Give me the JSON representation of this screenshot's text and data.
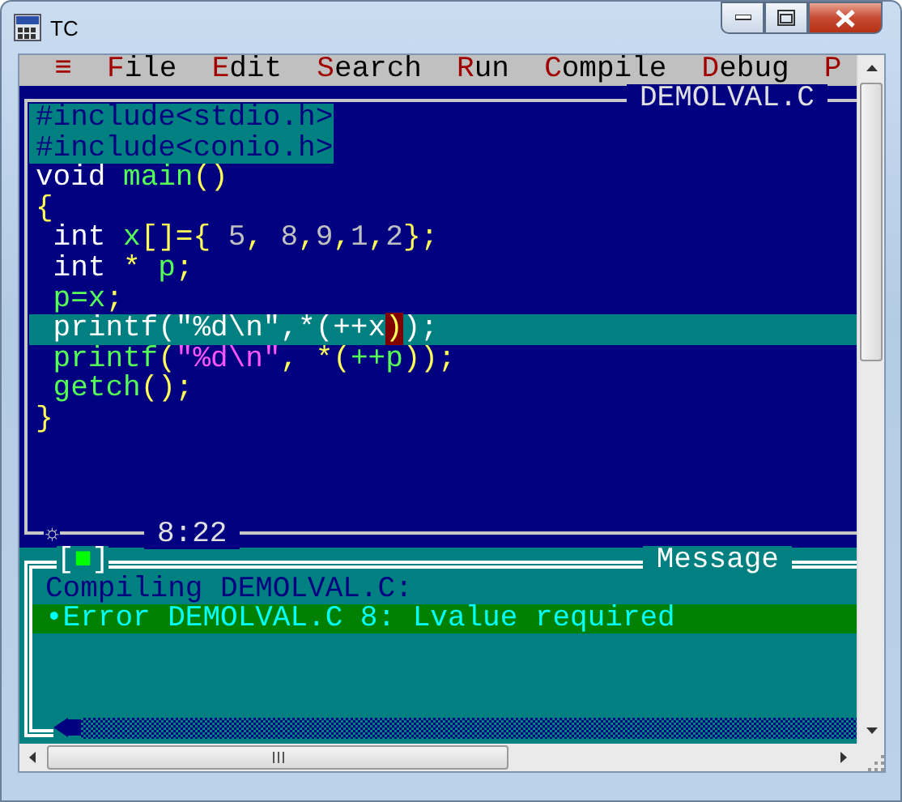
{
  "window": {
    "title": "TC"
  },
  "menu": [
    {
      "label": "≡"
    },
    {
      "label": "File"
    },
    {
      "label": "Edit"
    },
    {
      "label": "Search"
    },
    {
      "label": "Run"
    },
    {
      "label": "Compile"
    },
    {
      "label": "Debug"
    },
    {
      "label": "P"
    }
  ],
  "editor": {
    "title": "DEMOLVAL.C",
    "position": "8:22",
    "marker": "☼",
    "lines": [
      {
        "selected": true,
        "current": false,
        "tokens": [
          {
            "kind": "directive",
            "text": "#include<stdio.h>"
          }
        ]
      },
      {
        "selected": true,
        "current": false,
        "tokens": [
          {
            "kind": "directive",
            "text": "#include<conio.h>"
          }
        ]
      },
      {
        "selected": false,
        "current": false,
        "tokens": [
          {
            "kind": "keyword",
            "text": "void"
          },
          {
            "kind": "ident",
            "text": " main"
          },
          {
            "kind": "symbol",
            "text": "()"
          }
        ]
      },
      {
        "selected": false,
        "current": false,
        "tokens": [
          {
            "kind": "symbol",
            "text": "{"
          }
        ]
      },
      {
        "selected": false,
        "current": false,
        "tokens": [
          {
            "kind": "keyword",
            "text": " int"
          },
          {
            "kind": "ident",
            "text": " x"
          },
          {
            "kind": "symbol",
            "text": "[]={"
          },
          {
            "kind": "number",
            "text": " 5"
          },
          {
            "kind": "symbol",
            "text": ","
          },
          {
            "kind": "number",
            "text": " 8"
          },
          {
            "kind": "symbol",
            "text": ","
          },
          {
            "kind": "number",
            "text": "9"
          },
          {
            "kind": "symbol",
            "text": ","
          },
          {
            "kind": "number",
            "text": "1"
          },
          {
            "kind": "symbol",
            "text": ","
          },
          {
            "kind": "number",
            "text": "2"
          },
          {
            "kind": "symbol",
            "text": "};"
          }
        ]
      },
      {
        "selected": false,
        "current": false,
        "tokens": [
          {
            "kind": "keyword",
            "text": " int"
          },
          {
            "kind": "symbol",
            "text": " *"
          },
          {
            "kind": "ident",
            "text": " p"
          },
          {
            "kind": "symbol",
            "text": ";"
          }
        ]
      },
      {
        "selected": false,
        "current": false,
        "tokens": [
          {
            "kind": "ident",
            "text": " p=x"
          },
          {
            "kind": "symbol",
            "text": ";"
          }
        ]
      },
      {
        "selected": false,
        "current": true,
        "tokens": [
          {
            "kind": "plain",
            "text": " printf(\"%d\\n\",*(++x"
          },
          {
            "kind": "match",
            "text": ")"
          },
          {
            "kind": "plain",
            "text": ");"
          }
        ]
      },
      {
        "selected": false,
        "current": false,
        "tokens": [
          {
            "kind": "ident",
            "text": " printf"
          },
          {
            "kind": "symbol",
            "text": "("
          },
          {
            "kind": "string",
            "text": "\"%d\\n\""
          },
          {
            "kind": "symbol",
            "text": ", *("
          },
          {
            "kind": "ident",
            "text": "++p"
          },
          {
            "kind": "symbol",
            "text": "));"
          }
        ]
      },
      {
        "selected": false,
        "current": false,
        "tokens": [
          {
            "kind": "ident",
            "text": " getch"
          },
          {
            "kind": "symbol",
            "text": "();"
          }
        ]
      },
      {
        "selected": false,
        "current": false,
        "tokens": [
          {
            "kind": "symbol",
            "text": "}"
          }
        ]
      }
    ]
  },
  "message_panel": {
    "title": "Message",
    "close_box": "[■]",
    "lines": [
      {
        "text": "Compiling DEMOLVAL.C:",
        "selected": false
      },
      {
        "text": "•Error DEMOLVAL.C 8: Lvalue required",
        "selected": true
      }
    ]
  }
}
